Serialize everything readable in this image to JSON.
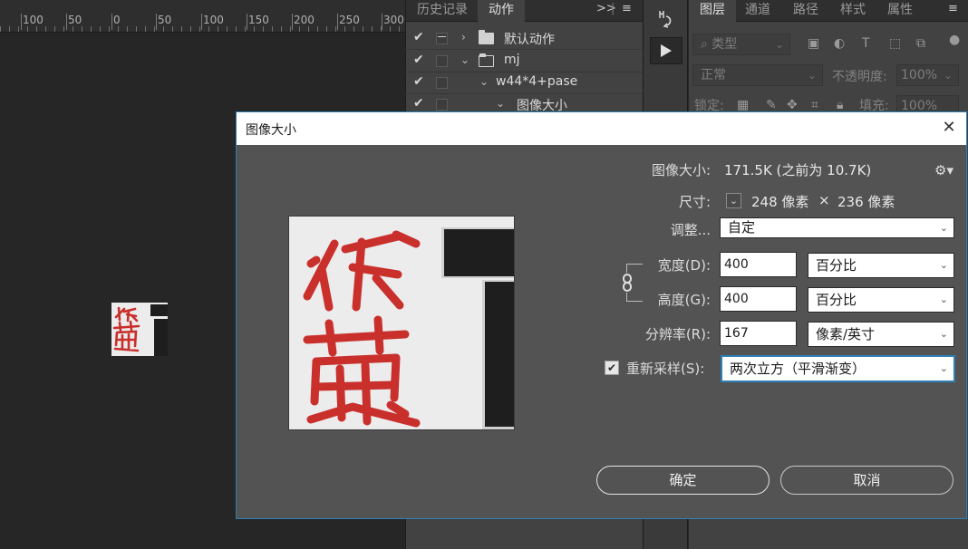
{
  "ruler": {
    "labels": [
      "100",
      "50",
      "0",
      "50",
      "100",
      "150",
      "200",
      "250",
      "300"
    ]
  },
  "actions_panel": {
    "tabs": [
      "历史记录",
      "动作"
    ],
    "active_tab": "动作",
    "expand_glyph": ">>",
    "menu_glyph": "≡",
    "rows": [
      {
        "label": "默认动作",
        "type": "set",
        "expanded": false,
        "checked": true,
        "dialog": true
      },
      {
        "label": "mj",
        "type": "set",
        "expanded": true,
        "checked": true,
        "dialog": false
      },
      {
        "label": "w44*4+pase",
        "type": "action",
        "expanded": true,
        "checked": true,
        "dialog": false
      },
      {
        "label": "图像大小",
        "type": "step",
        "expanded": true,
        "checked": true,
        "dialog": false
      }
    ]
  },
  "layers_panel": {
    "tabs": [
      "图层",
      "通道",
      "路径",
      "样式",
      "属性"
    ],
    "active_tab": "图层",
    "menu_glyph": "≡",
    "filter_label": "类型",
    "blend_mode": "正常",
    "opacity_label": "不透明度:",
    "opacity_value": "100%",
    "lock_label": "锁定:",
    "fill_label": "填充:",
    "fill_value": "100%"
  },
  "dialog": {
    "title": "图像大小",
    "close_glyph": "✕",
    "image_size_label": "图像大小:",
    "image_size_value": "171.5K (之前为 10.7K)",
    "dimensions_label": "尺寸:",
    "dimensions_width": "248 像素",
    "dimensions_times": "×",
    "dimensions_height": "236 像素",
    "fit_label": "调整...",
    "fit_value": "自定",
    "width_label": "宽度(D):",
    "width_value": "400",
    "width_unit": "百分比",
    "height_label": "高度(G):",
    "height_value": "400",
    "height_unit": "百分比",
    "resolution_label": "分辨率(R):",
    "resolution_value": "167",
    "resolution_unit": "像素/英寸",
    "resample_label": "重新采样(S):",
    "resample_checked": true,
    "resample_value": "两次立方（平滑渐变）",
    "ok_label": "确定",
    "cancel_label": "取消"
  },
  "colors": {
    "dialog_bg": "#535353",
    "accent_blue": "#2d7fb6",
    "seal_red": "#c9302c",
    "panel_bg": "#424242"
  }
}
